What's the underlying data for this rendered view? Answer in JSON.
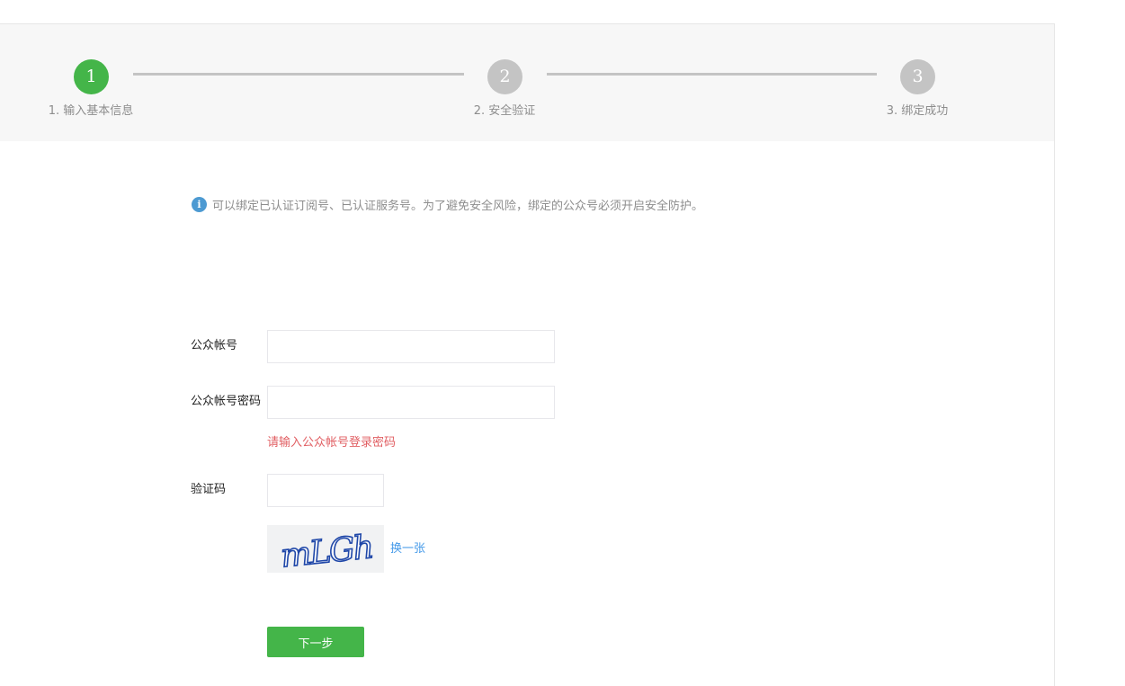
{
  "steps": [
    {
      "number": "1",
      "label": "1. 输入基本信息",
      "state": "active"
    },
    {
      "number": "2",
      "label": "2. 安全验证",
      "state": "inactive"
    },
    {
      "number": "3",
      "label": "3. 绑定成功",
      "state": "inactive"
    }
  ],
  "notice": {
    "icon": "info-icon",
    "icon_glyph": "i",
    "text": "可以绑定已认证订阅号、已认证服务号。为了避免安全风险，绑定的公众号必须开启安全防护。"
  },
  "form": {
    "account_label": "公众帐号",
    "account_value": "",
    "password_label": "公众帐号密码",
    "password_value": "",
    "password_error": "请输入公众帐号登录密码",
    "captcha_label": "验证码",
    "captcha_value": "",
    "captcha_image_text": "mLGh",
    "refresh_label": "换一张",
    "next_label": "下一步"
  },
  "colors": {
    "accent": "#44b549",
    "inactive_step": "#c4c4c4",
    "error": "#e15f63",
    "link": "#459ae9",
    "info": "#4d9ad2"
  }
}
